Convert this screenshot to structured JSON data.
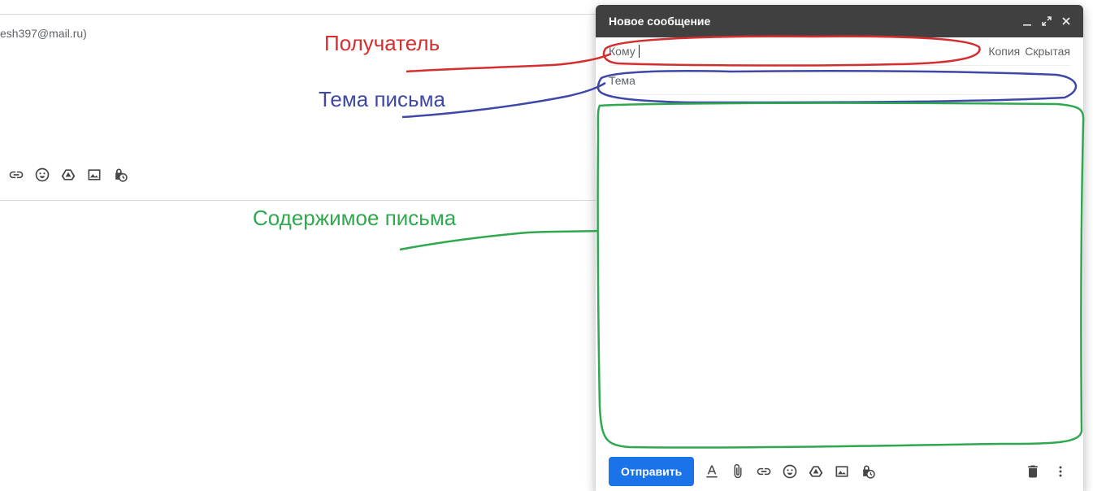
{
  "background": {
    "email_fragment": "esh397@mail.ru)"
  },
  "compose": {
    "title": "Новое сообщение",
    "to_label": "Кому",
    "cc_label": "Копия",
    "bcc_label": "Скрытая",
    "subject_placeholder": "Тема",
    "body_value": "",
    "send_label": "Отправить"
  },
  "annotations": {
    "recipient": "Получатель",
    "subject": "Тема письма",
    "content": "Содержимое письма"
  },
  "colors": {
    "header_bg": "#404040",
    "send_button": "#1a73e8",
    "annotation_red": "#d32f2f",
    "annotation_blue": "#3f47a8",
    "annotation_green": "#2fa84f"
  },
  "icons": {
    "toolbar": [
      "link-icon",
      "emoji-icon",
      "drive-icon",
      "photo-icon",
      "schedule-icon"
    ],
    "compose_footer": [
      "text-format-icon",
      "attach-icon",
      "link-icon",
      "emoji-icon",
      "drive-icon",
      "photo-icon",
      "schedule-icon"
    ],
    "compose_header": [
      "minimize-icon",
      "expand-icon",
      "close-icon"
    ],
    "footer_right": [
      "trash-icon",
      "more-vert-icon"
    ]
  }
}
